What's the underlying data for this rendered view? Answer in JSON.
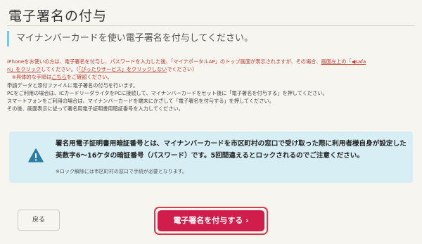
{
  "page": {
    "title": "電子署名の付与",
    "subhead": "マイナンバーカードを使い電子署名を付与してください。"
  },
  "instructions": {
    "line1_a": "iPhoneをお使いの方は、電子署名を付与し、パスワードを入力した後、「マイナポータルAP」のトップ画面が表示されますが、その場合、",
    "line1_link": "画面左上の「◀safa",
    "line2_link1": "ri」をクリック",
    "line2_b": "してください。（",
    "line2_link2": "「ぴったりサービス」をクリックしない",
    "line2_c": "でください）",
    "line3_a": "※具体的な手順は",
    "line3_link": "こちら",
    "line3_b": "をご確認ください。",
    "line4": "申請データと添付ファイルに電子署名の付与を行います。",
    "line5": "PCをご利用の場合は、ICカードリーダライタをPCに接続して、マイナンバーカードをセット後に「電子署名を付与する」を押してください。",
    "line6": "スマートフォンをご利用の場合は、マイナンバーカードを端末にかざして「電子署名を付与する」を押してください。",
    "line7": "その後、画面表示に従って署名用電子証明書用暗証番号を入力してください。"
  },
  "notice": {
    "icon": "warning-icon",
    "text": "署名用電子証明書用暗証番号とは、マイナンバーカードを市区町村の窓口で受け取った際に利用者様自身が設定した英数字6〜16ケタの暗証番号（パスワード）です。5回間違えるとロックされるのでご注意ください。",
    "small": "※ロック解除には市区町村の窓口で手続が必要となります。"
  },
  "buttons": {
    "back": "戻る",
    "submit": "電子署名を付与する ›"
  },
  "colors": {
    "accent_red": "#d11d4c",
    "notice_bg": "#d7eef4",
    "subhead_bar": "#7fc5dd"
  }
}
